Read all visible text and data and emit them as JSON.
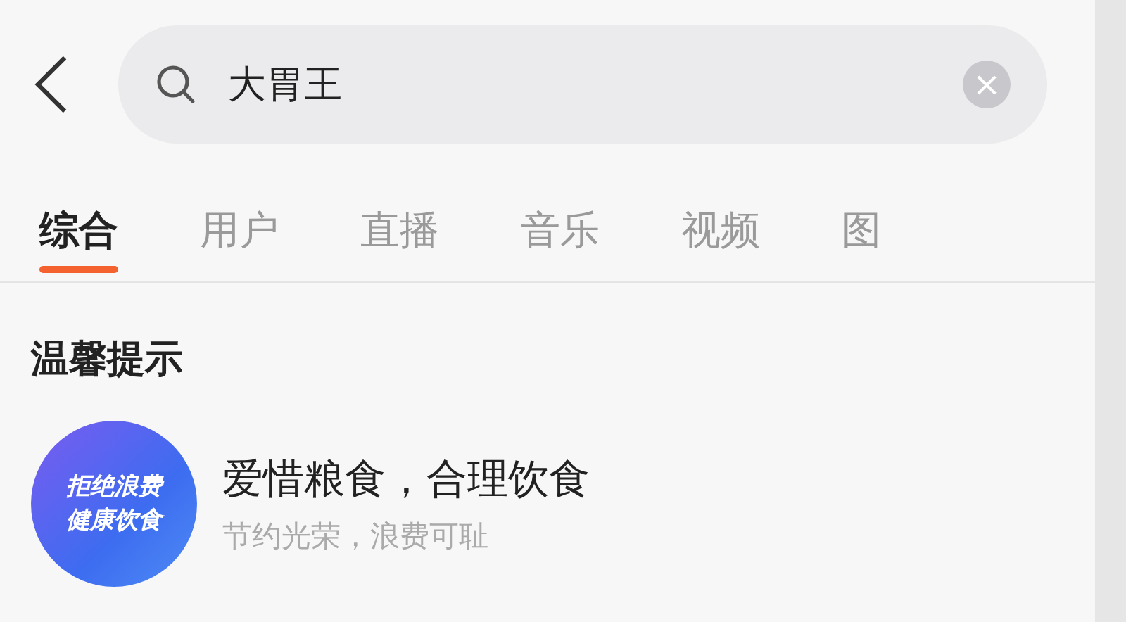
{
  "search": {
    "value": "大胃王",
    "clear": "×"
  },
  "tabs": [
    {
      "label": "综合",
      "selected": true
    },
    {
      "label": "用户",
      "selected": false
    },
    {
      "label": "直播",
      "selected": false
    },
    {
      "label": "音乐",
      "selected": false
    },
    {
      "label": "视频",
      "selected": false
    },
    {
      "label": "图",
      "selected": false
    }
  ],
  "section": {
    "title": "温馨提示"
  },
  "tip": {
    "badge": [
      "拒绝浪费",
      "健康饮食"
    ],
    "title": "爱惜粮食，合理饮食",
    "subtitle": "节约光荣，浪费可耻"
  }
}
